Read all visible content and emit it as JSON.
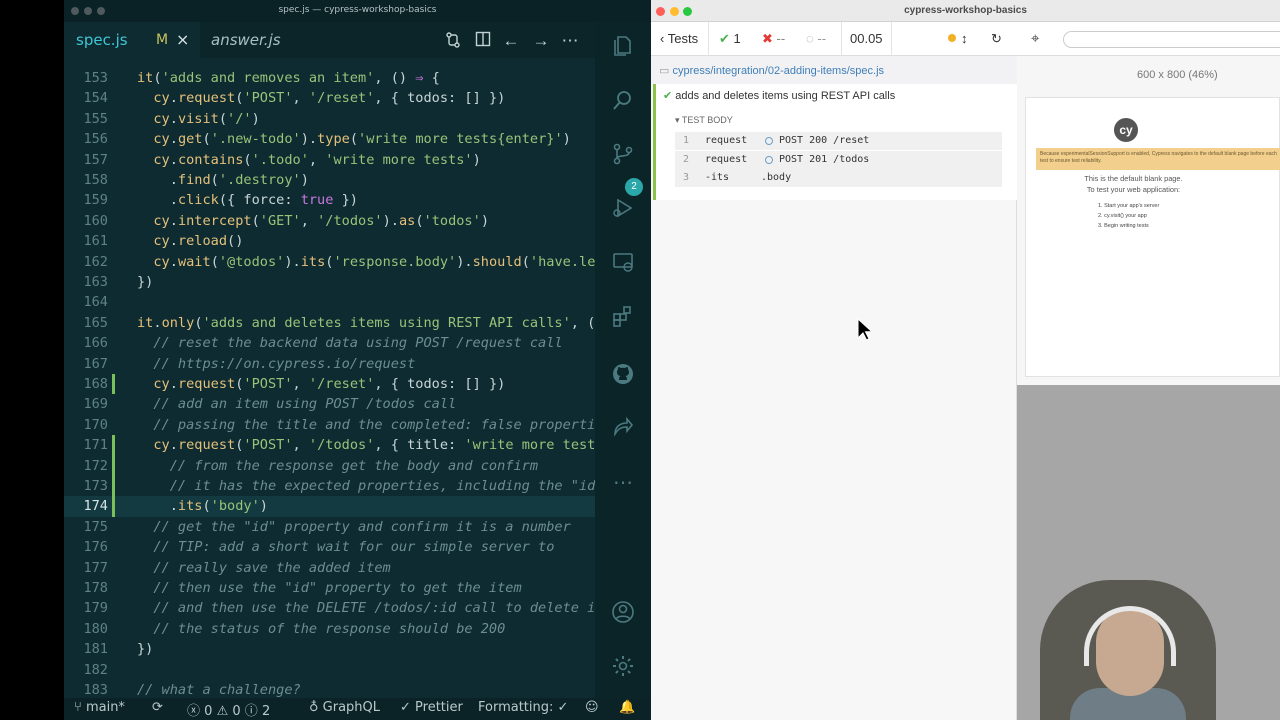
{
  "vscode": {
    "window_title": "spec.js — cypress-workshop-basics",
    "tabs": [
      {
        "label": "spec.js",
        "modified_marker": "M",
        "close": "×"
      },
      {
        "label": "answer.js"
      }
    ],
    "scm_badge": "2",
    "lines": [
      {
        "num": "153",
        "tokens": [
          [
            "fn",
            "it"
          ],
          [
            "pl",
            "("
          ],
          [
            "str",
            "'adds and removes an item'"
          ],
          [
            "pl",
            ", () "
          ],
          [
            "kw",
            "⇒"
          ],
          [
            "pl",
            " {"
          ]
        ]
      },
      {
        "num": "154",
        "tokens": [
          [
            "pl",
            "  "
          ],
          [
            "fn",
            "cy"
          ],
          [
            "pl",
            "."
          ],
          [
            "fn",
            "request"
          ],
          [
            "pl",
            "("
          ],
          [
            "str",
            "'POST'"
          ],
          [
            "pl",
            ", "
          ],
          [
            "str",
            "'/reset'"
          ],
          [
            "pl",
            ", { todos: [] })"
          ]
        ]
      },
      {
        "num": "155",
        "tokens": [
          [
            "pl",
            "  "
          ],
          [
            "fn",
            "cy"
          ],
          [
            "pl",
            "."
          ],
          [
            "fn",
            "visit"
          ],
          [
            "pl",
            "("
          ],
          [
            "str",
            "'/'"
          ],
          [
            "pl",
            ")"
          ]
        ]
      },
      {
        "num": "156",
        "tokens": [
          [
            "pl",
            "  "
          ],
          [
            "fn",
            "cy"
          ],
          [
            "pl",
            "."
          ],
          [
            "fn",
            "get"
          ],
          [
            "pl",
            "("
          ],
          [
            "str",
            "'.new-todo'"
          ],
          [
            "pl",
            ")."
          ],
          [
            "fn",
            "type"
          ],
          [
            "pl",
            "("
          ],
          [
            "str",
            "'write more tests{enter}'"
          ],
          [
            "pl",
            ")"
          ]
        ]
      },
      {
        "num": "157",
        "tokens": [
          [
            "pl",
            "  "
          ],
          [
            "fn",
            "cy"
          ],
          [
            "pl",
            "."
          ],
          [
            "fn",
            "contains"
          ],
          [
            "pl",
            "("
          ],
          [
            "str",
            "'.todo'"
          ],
          [
            "pl",
            ", "
          ],
          [
            "str",
            "'write more tests'"
          ],
          [
            "pl",
            ")"
          ]
        ]
      },
      {
        "num": "158",
        "tokens": [
          [
            "pl",
            "    ."
          ],
          [
            "fn",
            "find"
          ],
          [
            "pl",
            "("
          ],
          [
            "str",
            "'.destroy'"
          ],
          [
            "pl",
            ")"
          ]
        ]
      },
      {
        "num": "159",
        "tokens": [
          [
            "pl",
            "    ."
          ],
          [
            "fn",
            "click"
          ],
          [
            "pl",
            "({ force: "
          ],
          [
            "kw",
            "true"
          ],
          [
            "pl",
            " })"
          ]
        ]
      },
      {
        "num": "160",
        "tokens": [
          [
            "pl",
            "  "
          ],
          [
            "fn",
            "cy"
          ],
          [
            "pl",
            "."
          ],
          [
            "fn",
            "intercept"
          ],
          [
            "pl",
            "("
          ],
          [
            "str",
            "'GET'"
          ],
          [
            "pl",
            ", "
          ],
          [
            "str",
            "'/todos'"
          ],
          [
            "pl",
            ")."
          ],
          [
            "fn",
            "as"
          ],
          [
            "pl",
            "("
          ],
          [
            "str",
            "'todos'"
          ],
          [
            "pl",
            ")"
          ]
        ]
      },
      {
        "num": "161",
        "tokens": [
          [
            "pl",
            "  "
          ],
          [
            "fn",
            "cy"
          ],
          [
            "pl",
            "."
          ],
          [
            "fn",
            "reload"
          ],
          [
            "pl",
            "()"
          ]
        ]
      },
      {
        "num": "162",
        "tokens": [
          [
            "pl",
            "  "
          ],
          [
            "fn",
            "cy"
          ],
          [
            "pl",
            "."
          ],
          [
            "fn",
            "wait"
          ],
          [
            "pl",
            "("
          ],
          [
            "str",
            "'@todos'"
          ],
          [
            "pl",
            ")."
          ],
          [
            "fn",
            "its"
          ],
          [
            "pl",
            "("
          ],
          [
            "str",
            "'response.body'"
          ],
          [
            "pl",
            ")."
          ],
          [
            "fn",
            "should"
          ],
          [
            "pl",
            "("
          ],
          [
            "str",
            "'have.length'"
          ],
          [
            "pl",
            ","
          ]
        ]
      },
      {
        "num": "163",
        "tokens": [
          [
            "pl",
            "})"
          ]
        ]
      },
      {
        "num": "164",
        "tokens": []
      },
      {
        "num": "165",
        "tokens": [
          [
            "fn",
            "it"
          ],
          [
            "pl",
            "."
          ],
          [
            "fn",
            "only"
          ],
          [
            "pl",
            "("
          ],
          [
            "str",
            "'adds and deletes items using REST API calls'"
          ],
          [
            "pl",
            ", () "
          ],
          [
            "kw",
            "⇒"
          ],
          [
            "pl",
            " {"
          ]
        ]
      },
      {
        "num": "166",
        "tokens": [
          [
            "pl",
            "  "
          ],
          [
            "cm",
            "// reset the backend data using POST /request call"
          ]
        ]
      },
      {
        "num": "167",
        "tokens": [
          [
            "pl",
            "  "
          ],
          [
            "cm",
            "// https://on.cypress.io/request"
          ]
        ]
      },
      {
        "num": "168",
        "tokens": [
          [
            "pl",
            "  "
          ],
          [
            "fn",
            "cy"
          ],
          [
            "pl",
            "."
          ],
          [
            "fn",
            "request"
          ],
          [
            "pl",
            "("
          ],
          [
            "str",
            "'POST'"
          ],
          [
            "pl",
            ", "
          ],
          [
            "str",
            "'/reset'"
          ],
          [
            "pl",
            ", { todos: [] })"
          ]
        ]
      },
      {
        "num": "169",
        "tokens": [
          [
            "pl",
            "  "
          ],
          [
            "cm",
            "// add an item using POST /todos call"
          ]
        ]
      },
      {
        "num": "170",
        "tokens": [
          [
            "pl",
            "  "
          ],
          [
            "cm",
            "// passing the title and the completed: false properties"
          ]
        ]
      },
      {
        "num": "171",
        "tokens": [
          [
            "pl",
            "  "
          ],
          [
            "fn",
            "cy"
          ],
          [
            "pl",
            "."
          ],
          [
            "fn",
            "request"
          ],
          [
            "pl",
            "("
          ],
          [
            "str",
            "'POST'"
          ],
          [
            "pl",
            ", "
          ],
          [
            "str",
            "'/todos'"
          ],
          [
            "pl",
            ", { title: "
          ],
          [
            "str",
            "'write more tests'"
          ],
          [
            "pl",
            ", co"
          ]
        ]
      },
      {
        "num": "172",
        "tokens": [
          [
            "pl",
            "    "
          ],
          [
            "cm",
            "// from the response get the body and confirm"
          ]
        ]
      },
      {
        "num": "173",
        "tokens": [
          [
            "pl",
            "    "
          ],
          [
            "cm",
            "// it has the expected properties, including the \"id\""
          ]
        ]
      },
      {
        "num": "174",
        "tokens": [
          [
            "pl",
            "    ."
          ],
          [
            "fn",
            "its"
          ],
          [
            "pl",
            "("
          ],
          [
            "str",
            "'body'"
          ],
          [
            "pl",
            ")"
          ]
        ]
      },
      {
        "num": "175",
        "tokens": [
          [
            "pl",
            "  "
          ],
          [
            "cm",
            "// get the \"id\" property and confirm it is a number"
          ]
        ]
      },
      {
        "num": "176",
        "tokens": [
          [
            "pl",
            "  "
          ],
          [
            "cm",
            "// TIP: add a short wait for our simple server to"
          ]
        ]
      },
      {
        "num": "177",
        "tokens": [
          [
            "pl",
            "  "
          ],
          [
            "cm",
            "// really save the added item"
          ]
        ]
      },
      {
        "num": "178",
        "tokens": [
          [
            "pl",
            "  "
          ],
          [
            "cm",
            "// then use the \"id\" property to get the item"
          ]
        ]
      },
      {
        "num": "179",
        "tokens": [
          [
            "pl",
            "  "
          ],
          [
            "cm",
            "// and then use the DELETE /todos/:id call to delete it"
          ]
        ]
      },
      {
        "num": "180",
        "tokens": [
          [
            "pl",
            "  "
          ],
          [
            "cm",
            "// the status of the response should be 200"
          ]
        ]
      },
      {
        "num": "181",
        "tokens": [
          [
            "pl",
            "})"
          ]
        ]
      },
      {
        "num": "182",
        "tokens": []
      },
      {
        "num": "183",
        "tokens": [
          [
            "cm",
            "// what a challenge?"
          ]
        ]
      }
    ],
    "statusbar": {
      "branch": "main*",
      "errors": "0",
      "warnings": "0",
      "infos": "2",
      "graphql": "GraphQL",
      "prettier": "Prettier",
      "formatting": "Formatting: ✓"
    }
  },
  "cypress": {
    "window_title": "cypress-workshop-basics",
    "header": {
      "tests_label": "Tests",
      "passed": "1",
      "failed": "--",
      "pending": "--",
      "duration": "00.05"
    },
    "spec_path": "cypress/integration/02-adding-items/spec.js",
    "test_title": "adds and deletes items using REST API calls",
    "test_body_label": "TEST BODY",
    "commands": [
      {
        "num": "1",
        "name": "request",
        "message": "POST 200 /reset"
      },
      {
        "num": "2",
        "name": "request",
        "message": "POST 201 /todos"
      },
      {
        "num": "3",
        "name": "-its",
        "message": ".body"
      }
    ],
    "viewport_label": "600 x 800 (46%)",
    "aut": {
      "logo": "cy",
      "warning": "Because experimentalSessionSupport is enabled, Cypress navigates to the default blank page before each test to ensure test reliability.",
      "blank_title": "This is the default blank page.",
      "blank_subtitle": "To test your web application:",
      "steps": [
        "1. Start your app's server",
        "2. cy.visit() your app",
        "3. Begin writing tests"
      ]
    }
  },
  "colors": {
    "editor_bg": "#0d2b30",
    "function": "#e5c07b",
    "string": "#98c379",
    "keyword": "#c678dd",
    "comment": "#6d8d91",
    "pass_green": "#8bc34a"
  }
}
